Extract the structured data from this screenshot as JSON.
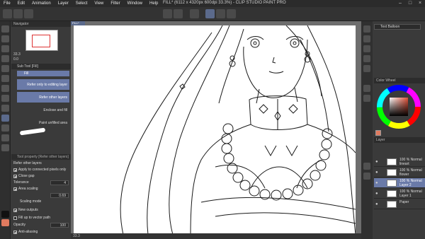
{
  "titlebar": {
    "menus": [
      "File",
      "Edit",
      "Animation",
      "Layer",
      "Select",
      "View",
      "Filter",
      "Window",
      "Help"
    ],
    "title": "FILL* (6112 x 4320px 600dpi 33.3%) - CLIP STUDIO PAINT PRO"
  },
  "canvas_tab": "FILL*",
  "navigator": {
    "title": "Navigator",
    "zoom": "33.3",
    "rotate": "0.0"
  },
  "subtool": {
    "header": "Sub Tool [Fill]",
    "tab": "Fill",
    "items": [
      "Refer only to editing layer",
      "Refer other layers",
      "Enclose and fill",
      "Paint unfilled area"
    ]
  },
  "tool_property": {
    "header": "Tool property [Refer other layers]",
    "title": "Refer other layers",
    "apply_connected": "Apply to connected pixels only",
    "close_gap": "Close gap",
    "tolerance_label": "Tolerance",
    "tolerance_value": "4",
    "area_scaling": "Area scaling",
    "area_scaling_value": "0.69",
    "scaling_mode": "Scaling mode",
    "new_outputs": "New outputs",
    "fill_vector": "Fill up to vector path",
    "opacity_label": "Opacity",
    "opacity_value": "100",
    "anti_aliasing": "Anti-aliasing"
  },
  "statusbar": {
    "zoom": "33.3"
  },
  "right": {
    "text_balloon": "Text Balloon",
    "color_wheel": "Color Wheel",
    "layer_header": "Layer",
    "layers": [
      {
        "name": "100 % Normal\nlineart"
      },
      {
        "name": "100 % Normal\nflower"
      },
      {
        "name": "100 % Normal\nLayer 2",
        "selected": true
      },
      {
        "name": "100 % Normal\nLayer 1"
      },
      {
        "name": "Paper"
      }
    ]
  },
  "colors": {
    "accent": "#6a7aa8",
    "paper": "#ffffff",
    "line": "#1a1a1a"
  }
}
